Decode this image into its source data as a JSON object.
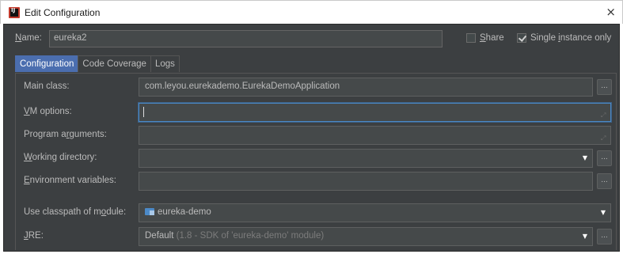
{
  "window": {
    "title": "Edit Configuration",
    "close_glyph": "×",
    "icon": "intellij-app-icon"
  },
  "name_field": {
    "label_prefix": "N",
    "label_rest": "ame:",
    "value": "eureka2"
  },
  "options": {
    "share": {
      "label_prefix": "S",
      "label_rest": "hare",
      "checked": false
    },
    "single_instance": {
      "label_before": "Single ",
      "label_ul": "i",
      "label_after": "nstance only",
      "checked": true
    }
  },
  "tabs": [
    {
      "label": "Configuration",
      "active": true
    },
    {
      "label": "Code Coverage",
      "active": false
    },
    {
      "label": "Logs",
      "active": false
    }
  ],
  "form": {
    "main_class": {
      "label": "Main class:",
      "value": "com.leyou.eurekademo.EurekaDemoApplication",
      "button": "..."
    },
    "vm_options": {
      "label_ul": "V",
      "label_rest": "M options:",
      "value": ""
    },
    "program_arguments": {
      "label_before": "Program a",
      "label_ul": "r",
      "label_after": "guments:",
      "value": ""
    },
    "working_directory": {
      "label_ul": "W",
      "label_rest": "orking directory:",
      "value": "",
      "button": "..."
    },
    "environment_variables": {
      "label_ul": "E",
      "label_rest": "nvironment variables:",
      "value": "",
      "button": "..."
    },
    "classpath_module": {
      "label_before": "Use classpath of m",
      "label_ul": "o",
      "label_after": "dule:",
      "value": "eureka-demo"
    },
    "jre": {
      "label_ul": "J",
      "label_rest": "RE:",
      "value_main": "Default",
      "value_detail": "(1.8 - SDK of 'eureka-demo' module)",
      "button": "..."
    }
  },
  "glyphs": {
    "dropdown": "▼",
    "expand": "⤢"
  },
  "colors": {
    "background": "#3c3f41",
    "field": "#45494a",
    "active_tab": "#4b6eaf",
    "focus_border": "#4a88c7"
  }
}
